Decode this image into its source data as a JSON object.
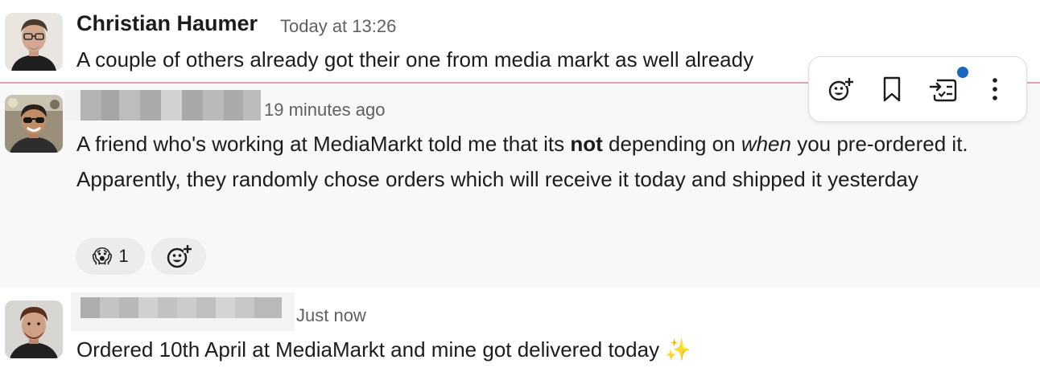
{
  "messages": [
    {
      "author": "Christian Haumer",
      "timestamp": "Today at 13:26",
      "text": "A couple of others already got their one from media markt as well already"
    },
    {
      "author_redacted": true,
      "timestamp": "19 minutes ago",
      "text_part1": "A friend who's working at MediaMarkt told me that its ",
      "text_bold": "not",
      "text_part2": " depending on ",
      "text_italic": "when",
      "text_part3": " you pre-ordered it. Apparently, they randomly chose orders which will receive it today and shipped it yesterday",
      "reactions": [
        {
          "emoji": "😱",
          "count": "1"
        }
      ],
      "add_reaction_icon": "add-emoji-icon"
    },
    {
      "author_redacted": true,
      "timestamp": "Just now",
      "text": "Ordered 10th April at MediaMarkt and mine got delivered today",
      "emoji": "✨"
    }
  ],
  "hover_toolbar": {
    "actions": [
      "add-reaction-icon",
      "bookmark-icon",
      "create-task-icon",
      "more-actions-icon"
    ],
    "badge_color": "#1d64c4"
  },
  "colors": {
    "new_message_divider": "#e8a1ae",
    "hover_background": "#f8f8f8"
  }
}
